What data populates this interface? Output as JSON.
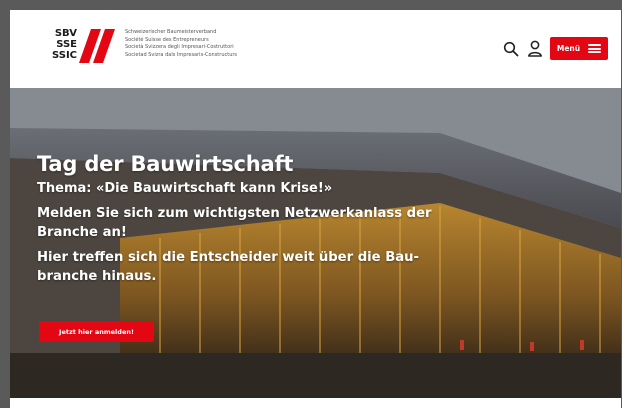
{
  "header": {
    "logo": {
      "abbreviations": [
        "SBV",
        "SSE",
        "SSIC"
      ],
      "lines": [
        "Schweizerischer Baumeisterverband",
        "Société Suisse des Entrepreneurs",
        "Società Svizzera degli Impresari-Costruttori",
        "Societad Svizra dals Impresaris-Constructurs"
      ],
      "brand_color": "#e30613"
    },
    "search_icon": "search-icon",
    "user_icon": "user-icon",
    "menu_label": "Menü"
  },
  "hero": {
    "title": "Tag der Bauwirtschaft",
    "theme": "Thema: «Die Bauwirtschaft kann Krise!»",
    "line1": "Melden Sie sich zum wichtigsten Netzwerkanlass der Branche an!",
    "line2": "Hier treffen sich die Entscheider weit über die Bau-branche hinaus.",
    "cta_label": "Jetzt hier anmelden!"
  },
  "colors": {
    "accent": "#e30613",
    "text_on_hero": "#ffffff"
  }
}
